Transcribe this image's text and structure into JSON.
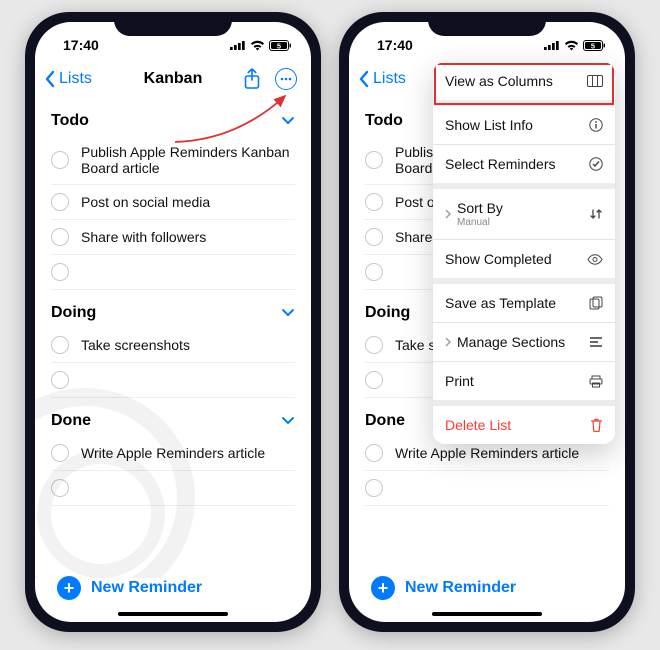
{
  "statusbar": {
    "time": "17:40",
    "battery_text": "5"
  },
  "nav": {
    "back_label": "Lists",
    "title": "Kanban"
  },
  "sections": [
    {
      "title": "Todo",
      "items": [
        "Publish Apple Reminders Kanban Board article",
        "Post on social media",
        "Share with followers"
      ]
    },
    {
      "title": "Doing",
      "items": [
        "Take screenshots"
      ]
    },
    {
      "title": "Done",
      "items": [
        "Write Apple Reminders article"
      ]
    }
  ],
  "new_reminder_label": "New Reminder",
  "popup": {
    "view_as_columns": "View as Columns",
    "show_list_info": "Show List Info",
    "select_reminders": "Select Reminders",
    "sort_by": "Sort By",
    "sort_by_value": "Manual",
    "show_completed": "Show Completed",
    "save_as_template": "Save as Template",
    "manage_sections": "Manage Sections",
    "print": "Print",
    "delete_list": "Delete List"
  }
}
